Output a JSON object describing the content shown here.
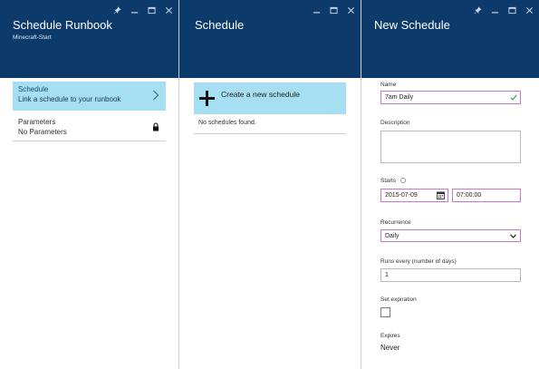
{
  "blade_runbook": {
    "title": "Schedule Runbook",
    "subtitle": "Minecraft-Start",
    "schedule_item": {
      "label": "Schedule",
      "sublabel": "Link a schedule to your runbook"
    },
    "parameters_item": {
      "label": "Parameters",
      "sublabel": "No Parameters"
    }
  },
  "blade_schedule": {
    "title": "Schedule",
    "create_label": "Create a new schedule",
    "empty_text": "No schedules found."
  },
  "blade_new_schedule": {
    "title": "New Schedule",
    "name": {
      "label": "Name",
      "value": "7am Daily"
    },
    "description": {
      "label": "Description",
      "value": ""
    },
    "starts": {
      "label": "Starts",
      "date": "2015-07-09",
      "time": "07:00:00"
    },
    "recurrence": {
      "label": "Recurrence",
      "value": "Daily"
    },
    "runs_every": {
      "label": "Runs every (number of days)",
      "value": "1"
    },
    "set_expiration": {
      "label": "Set expiration",
      "checked": false
    },
    "expires": {
      "label": "Expires",
      "value": "Never"
    }
  },
  "colors": {
    "header_bg": "#0c3a6b",
    "highlight_bg": "#a6dff1",
    "valid_check": "#3aa35a",
    "focus_border": "#c678c4"
  },
  "icons": [
    "pin-icon",
    "minimize-icon",
    "maximize-icon",
    "close-icon",
    "chevron-right-icon",
    "lock-icon",
    "plus-icon",
    "checkmark-icon",
    "calendar-icon",
    "chevron-down-icon",
    "info-icon"
  ]
}
